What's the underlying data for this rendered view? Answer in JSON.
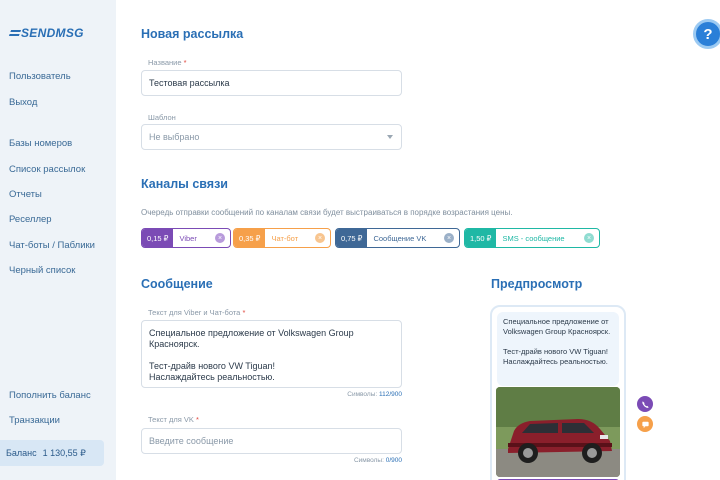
{
  "brand": {
    "logo_text": "SENDMSG"
  },
  "sidebar": {
    "items": [
      {
        "label": "Пользователь"
      },
      {
        "label": "Выход"
      },
      {
        "label": "Базы номеров"
      },
      {
        "label": "Список рассылок"
      },
      {
        "label": "Отчеты"
      },
      {
        "label": "Реселлер"
      },
      {
        "label": "Чат-боты / Паблики"
      },
      {
        "label": "Черный список"
      },
      {
        "label": "Пополнить баланс"
      },
      {
        "label": "Транзакции"
      }
    ],
    "balance": {
      "label": "Баланс",
      "value": "1 130,55 ₽"
    }
  },
  "form": {
    "title": "Новая рассылка",
    "name_label": "Название",
    "name_value": "Тестовая рассылка",
    "template_label": "Шаблон",
    "template_value": "Не выбрано",
    "required_mark": "*"
  },
  "channels": {
    "title": "Каналы связи",
    "hint": "Очередь отправки сообщений по каналам связи будет выстраиваться в порядке возрастания цены.",
    "items": [
      {
        "price": "0,15 ₽",
        "name": "Viber",
        "color": "#7b4bb5"
      },
      {
        "price": "0,35 ₽",
        "name": "Чат-бот",
        "color": "#f6a04a"
      },
      {
        "price": "0,75 ₽",
        "name": "Сообщение VK",
        "color": "#3f6896"
      },
      {
        "price": "1,50 ₽",
        "name": "SMS - сообщение",
        "color": "#1fb8a5"
      }
    ]
  },
  "message": {
    "title": "Сообщение",
    "viber_label": "Текст для Viber и Чат-бота",
    "viber_lines": [
      "Специальное предложение от Volkswagen Group",
      "Красноярск.",
      "",
      "Тест-драйв нового VW Tiguan!",
      "Наслаждайтесь реальностью."
    ],
    "viber_counter_label": "Символы:",
    "viber_counter_value": "112/900",
    "vk_label": "Текст для VK",
    "vk_placeholder": "Введите сообщение",
    "vk_counter_label": "Символы:",
    "vk_counter_value": "0/900"
  },
  "preview": {
    "title": "Предпросмотр",
    "lines": [
      "Специальное предложение от",
      "Volkswagen Group Красноярск.",
      "",
      "Тест-драйв нового VW Tiguan!",
      "Наслаждайтесь реальностью."
    ]
  },
  "help": {
    "label": "?"
  },
  "colors": {
    "accent": "#2a6fb5",
    "viber": "#7b4bb5",
    "chatbot": "#f6a04a",
    "vk": "#3f6896",
    "sms": "#1fb8a5"
  }
}
